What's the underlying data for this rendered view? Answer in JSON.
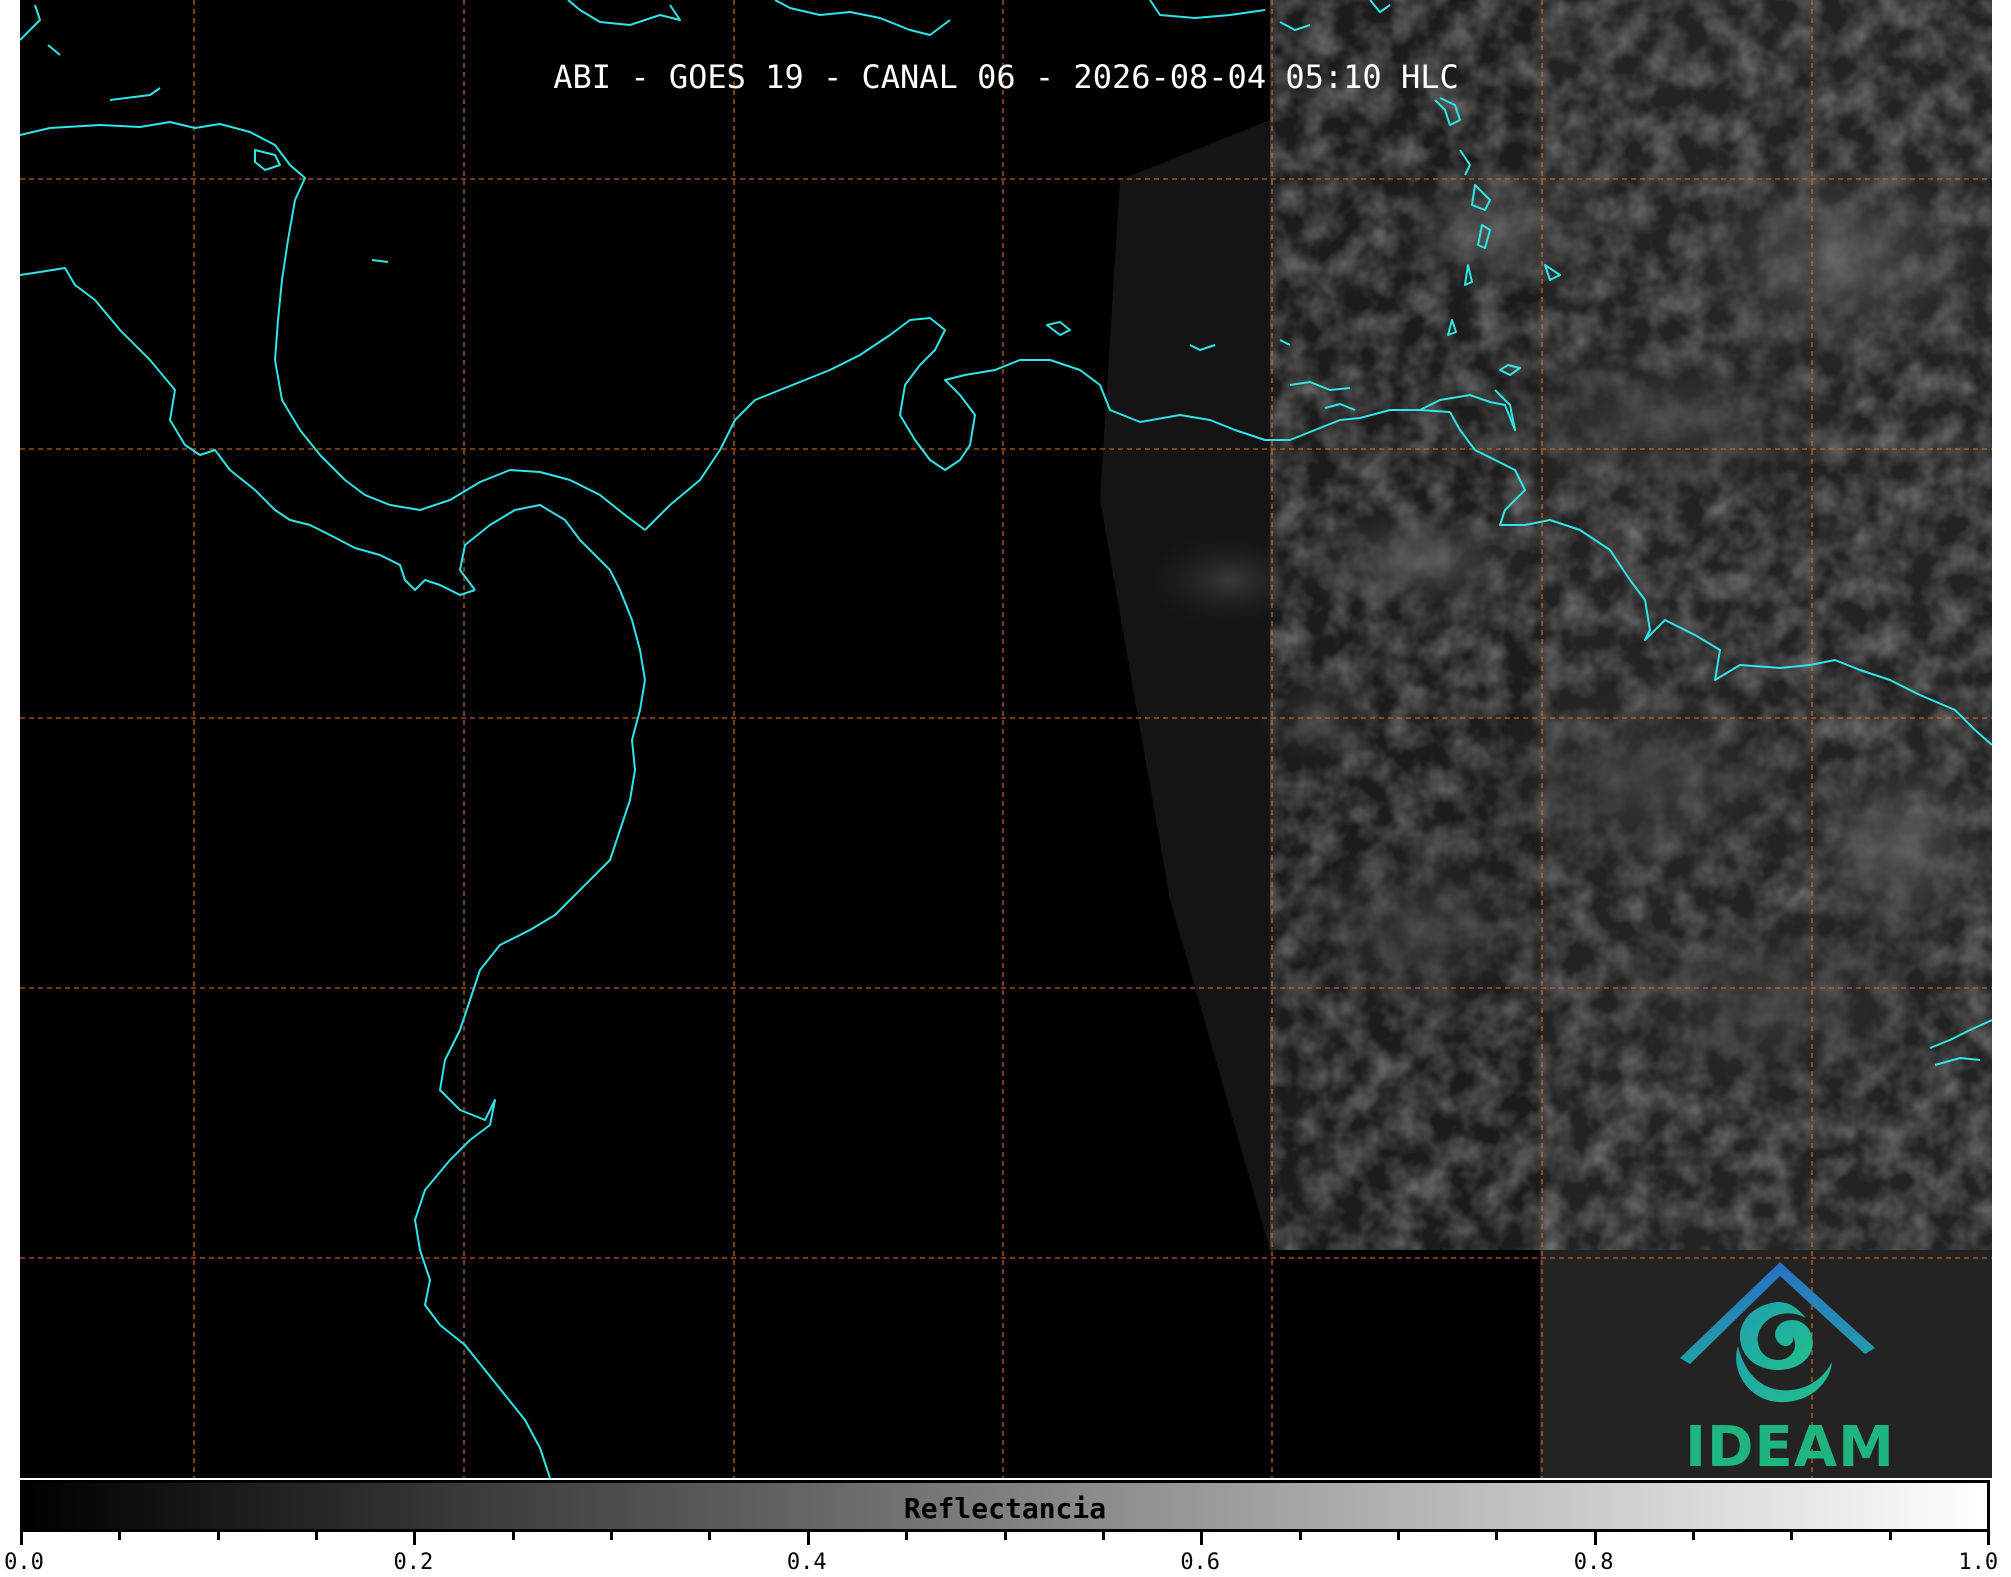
{
  "map": {
    "title": "ABI - GOES 19 - CANAL 06 - 2026-08-04 05:10 HLC",
    "coastline_color": "#2ee6e6",
    "grid_color": "#d2691e",
    "background_color": "#000000"
  },
  "logo": {
    "text": "IDEAM",
    "roof_color": "#2a7fc0",
    "swirl_color": "#1fb59a",
    "text_color": "#1fb57e"
  },
  "colorbar": {
    "label": "Reflectancia",
    "min": 0.0,
    "max": 1.0,
    "tick_labels": [
      "0.0",
      "0.2",
      "0.4",
      "0.6",
      "0.8",
      "1.0"
    ],
    "gradient_start": "#000000",
    "gradient_end": "#ffffff"
  }
}
